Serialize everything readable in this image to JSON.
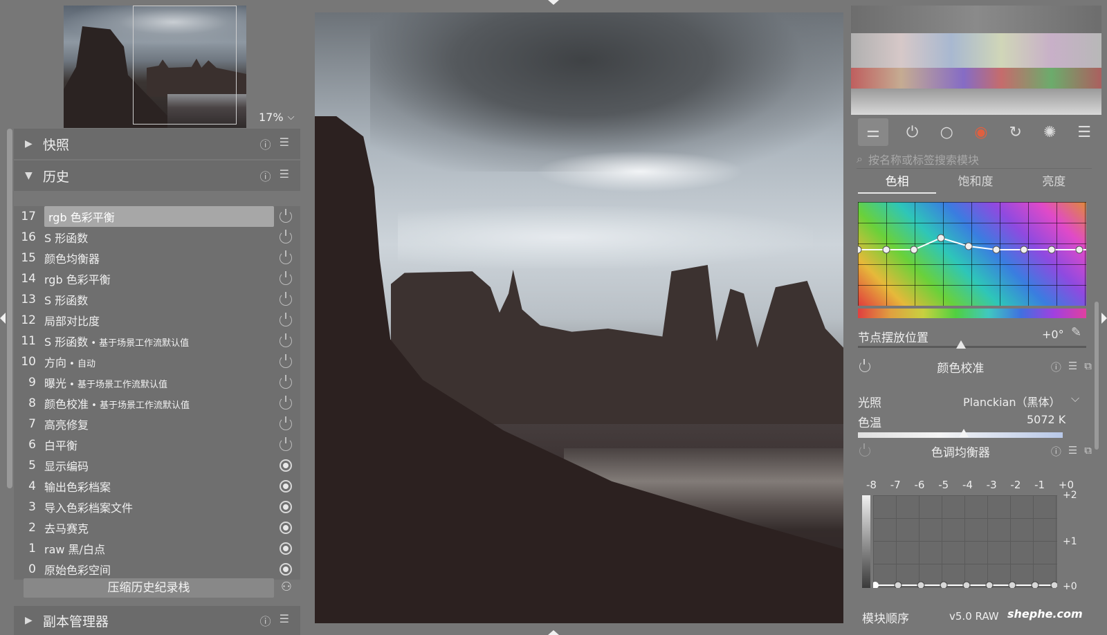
{
  "navigator": {
    "zoom": "17%"
  },
  "sections": {
    "snapshots": "快照",
    "history": "历史",
    "duplicate_manager": "副本管理器"
  },
  "history": [
    {
      "num": "17",
      "label": "rgb 色彩平衡",
      "sub": "",
      "icon": "power"
    },
    {
      "num": "16",
      "label": "S 形函数",
      "sub": "",
      "icon": "power"
    },
    {
      "num": "15",
      "label": "颜色均衡器",
      "sub": "",
      "icon": "power"
    },
    {
      "num": "14",
      "label": "rgb 色彩平衡",
      "sub": "",
      "icon": "power"
    },
    {
      "num": "13",
      "label": "S 形函数",
      "sub": "",
      "icon": "power"
    },
    {
      "num": "12",
      "label": "局部对比度",
      "sub": "",
      "icon": "power"
    },
    {
      "num": "11",
      "label": "S 形函数",
      "sub": " • 基于场景工作流默认值",
      "icon": "power"
    },
    {
      "num": "10",
      "label": "方向",
      "sub": " • 自动",
      "icon": "power"
    },
    {
      "num": "9",
      "label": "曝光",
      "sub": " • 基于场景工作流默认值",
      "icon": "power"
    },
    {
      "num": "8",
      "label": "颜色校准",
      "sub": " • 基于场景工作流默认值",
      "icon": "power"
    },
    {
      "num": "7",
      "label": "高亮修复",
      "sub": "",
      "icon": "power"
    },
    {
      "num": "6",
      "label": "白平衡",
      "sub": "",
      "icon": "power"
    },
    {
      "num": "5",
      "label": "显示编码",
      "sub": "",
      "icon": "always-on"
    },
    {
      "num": "4",
      "label": "输出色彩档案",
      "sub": "",
      "icon": "always-on"
    },
    {
      "num": "3",
      "label": "导入色彩档案文件",
      "sub": "",
      "icon": "always-on"
    },
    {
      "num": "2",
      "label": "去马赛克",
      "sub": "",
      "icon": "always-on"
    },
    {
      "num": "1",
      "label": "raw 黑/白点",
      "sub": "",
      "icon": "always-on"
    },
    {
      "num": "0",
      "label": "原始色彩空间",
      "sub": "",
      "icon": "always-on"
    }
  ],
  "history_selected_index": 0,
  "compress_label": "压缩历史纪录栈",
  "right": {
    "search_placeholder": "按名称或标签搜索模块",
    "tabs": [
      "色相",
      "饱和度",
      "亮度"
    ],
    "node_label": "节点摆放位置",
    "node_value": "+0°",
    "color_calibration": {
      "title": "颜色校准",
      "illuminant_label": "光照",
      "illuminant_value": "Planckian（黑体）",
      "temp_label": "色温",
      "temp_value": "5072 K"
    },
    "tone_equalizer": {
      "title": "色调均衡器",
      "zones": [
        "-8",
        "-7",
        "-6",
        "-5",
        "-4",
        "-3",
        "-2",
        "-1",
        "+0"
      ],
      "y_labels": [
        "+2",
        "+1",
        "+0"
      ]
    },
    "module_order_label": "模块顺序",
    "module_order_value": "v5.0 RAW",
    "watermark": "shephe.com"
  },
  "icons": {
    "collapse": "triangle-right-icon",
    "expand": "triangle-down-icon",
    "reset": "reset-icon",
    "presets": "hamburger-menu-icon"
  }
}
